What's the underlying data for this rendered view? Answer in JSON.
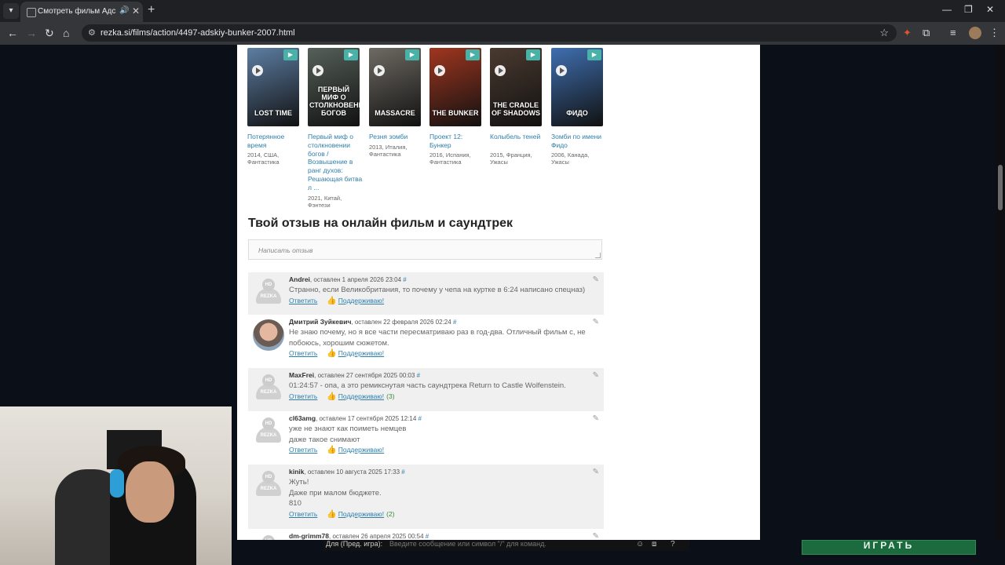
{
  "browser": {
    "tab_title": "Смотреть фильм Адский бункер",
    "url": "rezka.si/films/action/4497-adskiy-bunker-2007.html",
    "tab_menu_icon": "chevron-down-icon",
    "new_tab_icon": "plus-icon"
  },
  "related_films": [
    {
      "title": "Потерянное время",
      "meta": "2014, США, Фантастика",
      "poster_text": "LOST TIME",
      "poster_color": "#5d7ea3"
    },
    {
      "title": "Первый миф о столкновении богов / Возвышение в ранг духов: Решающая битва л ...",
      "meta": "2021, Китай, Фэнтези",
      "poster_text": "ПЕРВЫЙ МИФ О СТОЛКНОВЕНИИ БОГОВ",
      "poster_color": "#56605a"
    },
    {
      "title": "Резня зомби",
      "meta": "2013, Италия, Фантастика",
      "poster_text": "MASSACRE",
      "poster_color": "#6e6a63"
    },
    {
      "title": "Проект 12: Бункер",
      "meta": "2016, Испания, Фантастика",
      "poster_text": "THE BUNKER",
      "poster_color": "#a0361f"
    },
    {
      "title": "Колыбель теней",
      "meta": "2015, Франция, Ужасы",
      "poster_text": "THE CRADLE OF SHADOWS",
      "poster_color": "#4a3a30"
    },
    {
      "title": "Зомби по имени Фидо",
      "meta": "2006, Канада, Ужасы",
      "poster_text": "ФИДО",
      "poster_color": "#3f6fb0"
    }
  ],
  "reviews": {
    "heading": "Твой отзыв на онлайн фильм и саундтрек",
    "placeholder": "Написать отзыв"
  },
  "comments": [
    {
      "author": "Andrei",
      "meta": ", оставлен 1 апреля 2026 23:04",
      "hash": "#",
      "lines": [
        "Странно, если Великобритания, то почему у чепа на куртке в 6:24 написано спецназ)"
      ],
      "reply": "Ответить",
      "support": "Поддерживаю!",
      "count": ""
    },
    {
      "author": "Дмитрий Зуйкевич",
      "meta": ", оставлен 22 февраля 2026 02:24",
      "hash": "#",
      "lines": [
        "Не знаю почему, но я все части пересматриваю раз в год-два. Отличный фильм с, не",
        "побоюсь, хорошим сюжетом."
      ],
      "reply": "Ответить",
      "support": "Поддерживаю!",
      "count": ""
    },
    {
      "author": "MaxFrei",
      "meta": ", оставлен 27 сентября 2025 00:03",
      "hash": "#",
      "lines": [
        "01:24:57 - опа, а это ремикснутая часть саундтрека Return to Castle Wolfenstein."
      ],
      "reply": "Ответить",
      "support": "Поддерживаю!",
      "count": "(3)"
    },
    {
      "author": "cl63amg",
      "meta": ", оставлен 17 сентября 2025 12:14",
      "hash": "#",
      "lines": [
        "уже не знают как поиметь немцев",
        "даже такое снимают"
      ],
      "reply": "Ответить",
      "support": "Поддерживаю!",
      "count": ""
    },
    {
      "author": "kinik",
      "meta": ", оставлен 10 августа 2025 17:33",
      "hash": "#",
      "lines": [
        "Жуть!",
        "Даже при малом бюджете.",
        "810"
      ],
      "reply": "Ответить",
      "support": "Поддерживаю!",
      "count": "(2)"
    },
    {
      "author": "dm-grimm78",
      "meta": ", оставлен 26 апреля 2025 00:54",
      "hash": "#",
      "lines": [],
      "reply": "",
      "support": "",
      "count": ""
    }
  ],
  "avatar_label": {
    "top": "HD",
    "bottom": "REZKA"
  },
  "overlay": {
    "label": "Для (Пред. игра):",
    "input_placeholder": "Введите сообщение или символ \"/\" для команд."
  },
  "play_button": "ИГРАТЬ"
}
